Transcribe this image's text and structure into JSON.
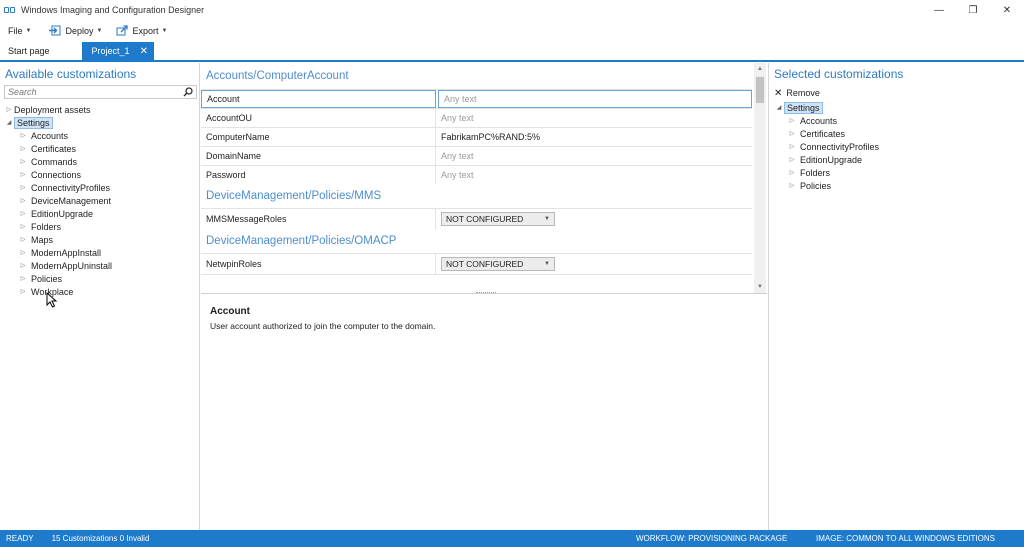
{
  "window": {
    "title": "Windows Imaging and Configuration Designer",
    "controls": [
      "—",
      "❐",
      "✕"
    ]
  },
  "menubar": {
    "file": "File",
    "deploy": "Deploy",
    "export": "Export"
  },
  "tabs": {
    "start": "Start page",
    "project": "Project_1",
    "close": "✕"
  },
  "left": {
    "title": "Available customizations",
    "search_placeholder": "Search",
    "tree": {
      "deployment_assets": "Deployment assets",
      "settings": "Settings",
      "children": [
        "Accounts",
        "Certificates",
        "Commands",
        "Connections",
        "ConnectivityProfiles",
        "DeviceManagement",
        "EditionUpgrade",
        "Folders",
        "Maps",
        "ModernAppInstall",
        "ModernAppUninstall",
        "Policies",
        "Workplace"
      ]
    }
  },
  "center": {
    "sections": [
      {
        "title": "Accounts/ComputerAccount",
        "rows": [
          {
            "label": "Account",
            "value": "Any text",
            "placeholder": true
          },
          {
            "label": "AccountOU",
            "value": "Any text",
            "placeholder": true
          },
          {
            "label": "ComputerName",
            "value": "FabrikamPC%RAND:5%",
            "placeholder": false
          },
          {
            "label": "DomainName",
            "value": "Any text",
            "placeholder": true
          },
          {
            "label": "Password",
            "value": "Any text",
            "placeholder": true
          }
        ]
      },
      {
        "title": "DeviceManagement/Policies/MMS",
        "rows": [
          {
            "label": "MMSMessageRoles",
            "value": "NOT CONFIGURED"
          }
        ]
      },
      {
        "title": "DeviceManagement/Policies/OMACP",
        "rows": [
          {
            "label": "NetwpinRoles",
            "value": "NOT CONFIGURED"
          }
        ]
      }
    ],
    "description": {
      "title": "Account",
      "text": "User account authorized to join the computer to the domain."
    }
  },
  "right": {
    "title": "Selected customizations",
    "remove": "Remove",
    "settings": "Settings",
    "children": [
      "Accounts",
      "Certificates",
      "ConnectivityProfiles",
      "EditionUpgrade",
      "Folders",
      "Policies"
    ]
  },
  "status": {
    "ready": "READY",
    "counts": "15 Customizations 0 Invalid",
    "workflow": "WORKFLOW: PROVISIONING PACKAGE",
    "image": "IMAGE: COMMON TO ALL WINDOWS EDITIONS"
  },
  "colors": {
    "accent": "#1e7acb",
    "section_title": "#4c8ed0",
    "selection": "#cfe3f6"
  }
}
